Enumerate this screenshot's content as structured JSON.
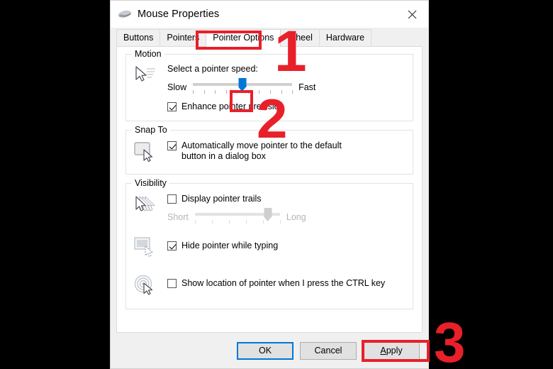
{
  "window": {
    "title": "Mouse Properties",
    "icon": "mouse-icon",
    "close_label": "✕"
  },
  "tabs": [
    {
      "label": "Buttons",
      "active": false
    },
    {
      "label": "Pointers",
      "active": false
    },
    {
      "label": "Pointer Options",
      "active": true
    },
    {
      "label": "Wheel",
      "active": false
    },
    {
      "label": "Hardware",
      "active": false
    }
  ],
  "groups": {
    "motion": {
      "title": "Motion",
      "icon": "pointer-speed-icon",
      "speed_label": "Select a pointer speed:",
      "slider": {
        "min_label": "Slow",
        "max_label": "Fast",
        "value_percent": 50,
        "tick_count": 10,
        "enabled": true
      },
      "enhance_precision": {
        "label": "Enhance pointer precision",
        "checked": true
      }
    },
    "snap_to": {
      "title": "Snap To",
      "icon": "snap-to-button-icon",
      "auto_move": {
        "label": "Automatically move pointer to the default button in a dialog box",
        "checked": true
      }
    },
    "visibility": {
      "title": "Visibility",
      "trails_icon": "pointer-trails-icon",
      "display_trails": {
        "label": "Display pointer trails",
        "checked": false
      },
      "trails_slider": {
        "min_label": "Short",
        "max_label": "Long",
        "value_percent": 86,
        "tick_count": 6,
        "enabled": false
      },
      "hide_icon": "hide-pointer-typing-icon",
      "hide_while_typing": {
        "label": "Hide pointer while typing",
        "checked": true
      },
      "ctrl_icon": "ctrl-locate-pointer-icon",
      "show_location": {
        "label": "Show location of pointer when I press the CTRL key",
        "checked": false
      }
    }
  },
  "footer": {
    "ok": "OK",
    "cancel": "Cancel",
    "apply_prefix": "A",
    "apply_suffix": "pply"
  },
  "annotations": {
    "accent_color": "#e8202a",
    "steps": [
      {
        "number": "1"
      },
      {
        "number": "2"
      },
      {
        "number": "3"
      }
    ]
  }
}
